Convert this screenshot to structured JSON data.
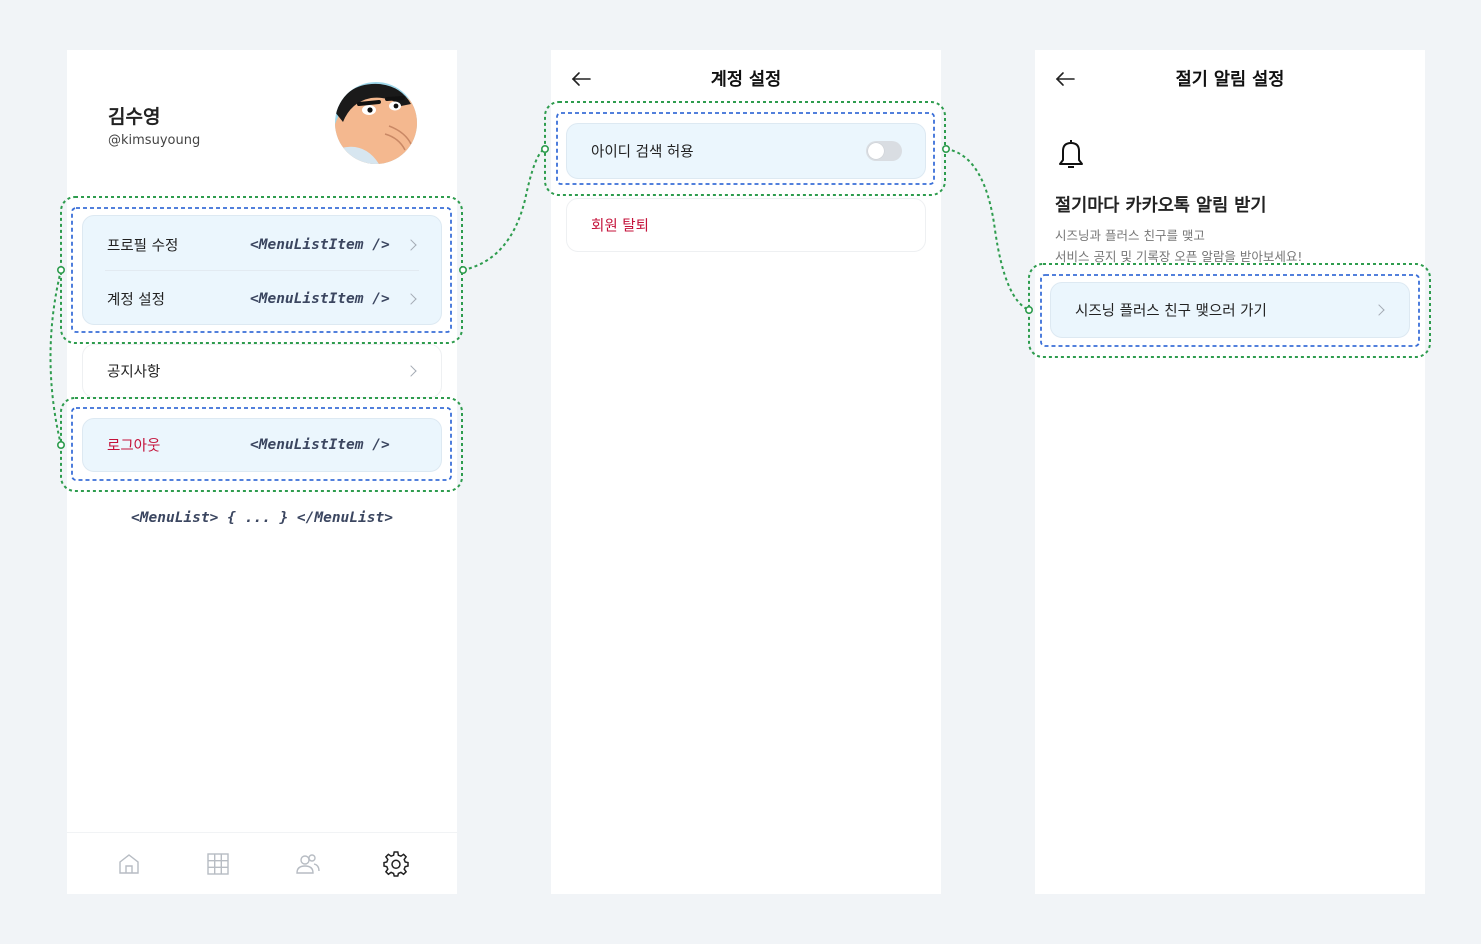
{
  "screen1": {
    "profile": {
      "name": "김수영",
      "handle": "@kimsuyoung"
    },
    "group_a": [
      {
        "label": "프로필 수정",
        "component": "<MenuListItem />"
      },
      {
        "label": "계정 설정",
        "component": "<MenuListItem />"
      }
    ],
    "notice": {
      "label": "공지사항"
    },
    "logout": {
      "label": "로그아웃",
      "component": "<MenuListItem />"
    },
    "caption": "<MenuList> { ... } </MenuList>",
    "tabbar": [
      "home-icon",
      "grid-icon",
      "friends-icon",
      "settings-icon"
    ]
  },
  "screen2": {
    "title": "계정 설정",
    "search_toggle": {
      "label": "아이디 검색 허용",
      "on": false
    },
    "withdraw": {
      "label": "회원 탈퇴"
    }
  },
  "screen3": {
    "title": "절기 알림 설정",
    "heading": "절기마다 카카오톡 알림 받기",
    "desc_line1": "시즈닝과 플러스 친구를 맺고",
    "desc_line2": "서비스 공지 및 기록장 오픈 알람을 받아보세요!",
    "cta": {
      "label": "시즈닝 플러스 친구 맺으러 가기"
    }
  },
  "colors": {
    "background": "#f1f4f7",
    "card_highlight": "#ebf6fd",
    "danger": "#c4123a",
    "annotation_green": "#2e9c4e",
    "annotation_blue": "#3a6fd8",
    "code_text": "#3b4660"
  }
}
